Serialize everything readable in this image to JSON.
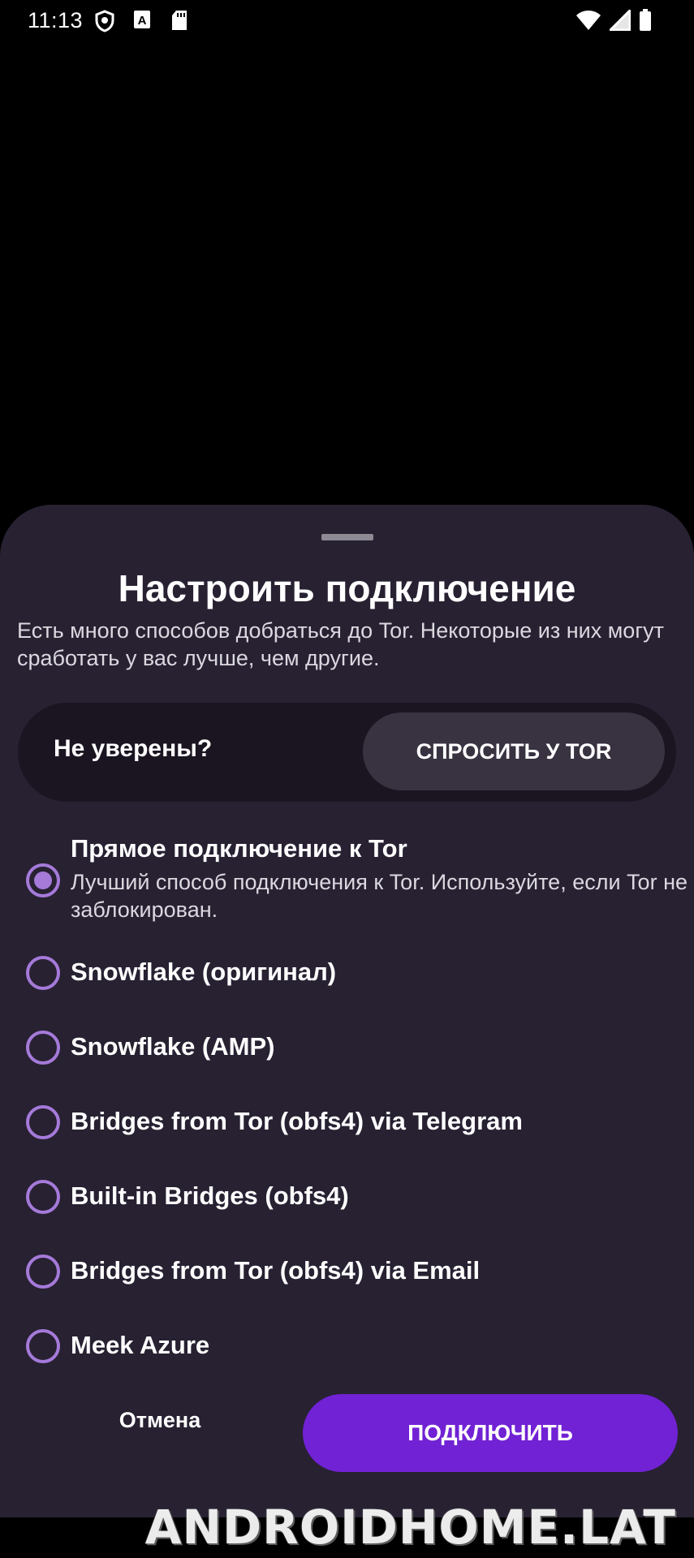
{
  "status_bar": {
    "time": "11:13",
    "left_icons": [
      "shield-icon",
      "keyboard-a-icon",
      "sd-card-icon"
    ],
    "right_icons": [
      "wifi-icon",
      "signal-icon",
      "battery-icon"
    ]
  },
  "sheet": {
    "title": "Настроить подключение",
    "subtitle": "Есть много способов добраться до Tor. Некоторые из них могут сработать у вас лучше, чем другие.",
    "ask": {
      "label": "Не уверены?",
      "button": "СПРОСИТЬ У TOR"
    },
    "options": [
      {
        "title": "Прямое подключение к Tor",
        "description": "Лучший способ подключения к Tor. Используйте, если Tor не заблокирован.",
        "selected": true
      },
      {
        "title": "Snowflake (оригинал)",
        "selected": false
      },
      {
        "title": "Snowflake (AMP)",
        "selected": false
      },
      {
        "title": "Bridges from Tor (obfs4) via Telegram",
        "selected": false
      },
      {
        "title": "Built-in Bridges (obfs4)",
        "selected": false
      },
      {
        "title": "Bridges from Tor (obfs4) via Email",
        "selected": false
      },
      {
        "title": "Meek Azure",
        "selected": false
      }
    ],
    "cancel_label": "Отмена",
    "connect_label": "ПОДКЛЮЧИТЬ"
  },
  "colors": {
    "sheet_background": "#272132",
    "accent": "#7122d4",
    "radio": "#a57ad9"
  },
  "watermark": "ANDROIDHOME.LAT"
}
